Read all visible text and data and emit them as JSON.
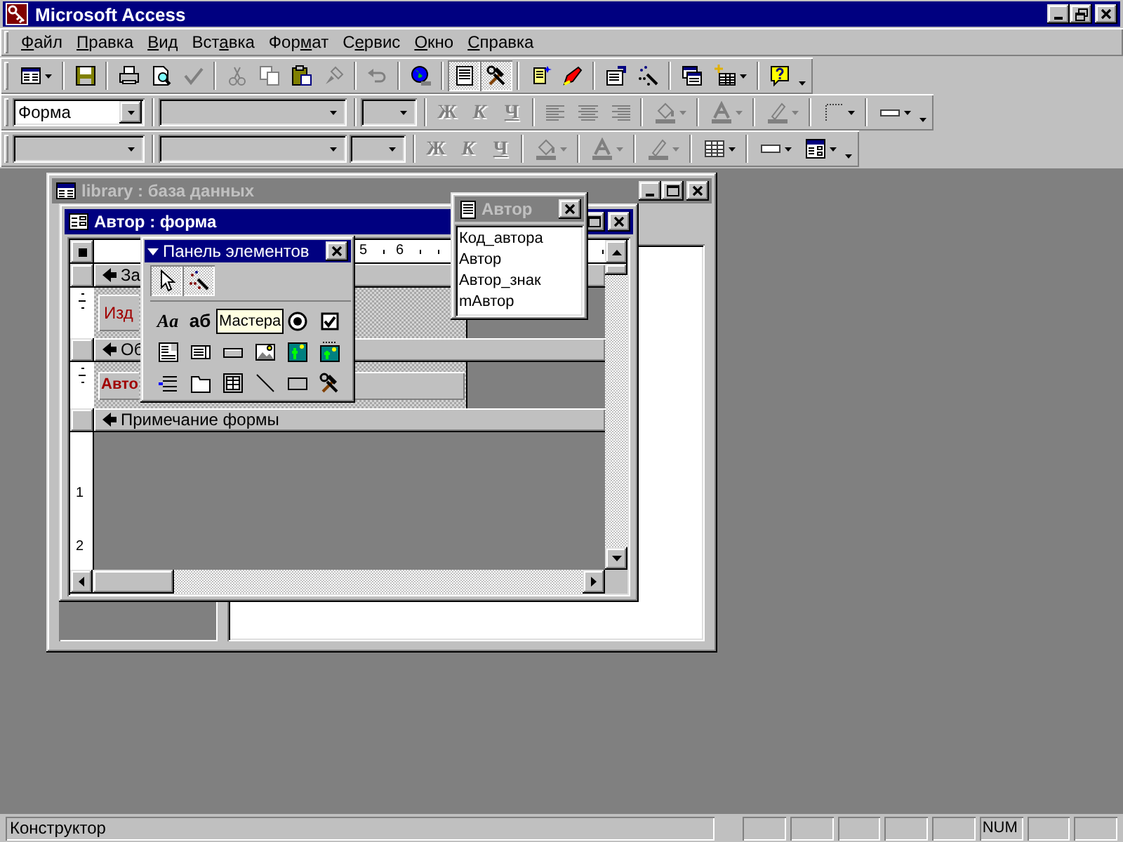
{
  "app_title": "Microsoft Access",
  "menu": [
    {
      "key": "Ф",
      "post": "айл"
    },
    {
      "key": "П",
      "post": "равка"
    },
    {
      "key": "В",
      "post": "ид"
    },
    {
      "pre": "Вст",
      "key": "а",
      "post": "вка"
    },
    {
      "pre": "Фор",
      "key": "м",
      "post": "ат"
    },
    {
      "pre": "С",
      "key": "е",
      "post": "рвис"
    },
    {
      "key": "О",
      "post": "кно"
    },
    {
      "key": "С",
      "post": "правка"
    }
  ],
  "toolbars": [
    {
      "items": [
        {
          "kind": "view",
          "split": true,
          "disabled": false,
          "pressed": false
        },
        {
          "kind": "separator"
        },
        {
          "kind": "save",
          "disabled": false,
          "pressed": false
        },
        {
          "kind": "separator"
        },
        {
          "kind": "print",
          "disabled": false,
          "pressed": false
        },
        {
          "kind": "preview",
          "disabled": false,
          "pressed": false
        },
        {
          "kind": "spelling",
          "disabled": true,
          "pressed": false
        },
        {
          "kind": "separator"
        },
        {
          "kind": "cut",
          "disabled": true,
          "pressed": false
        },
        {
          "kind": "copy",
          "disabled": true,
          "pressed": false
        },
        {
          "kind": "paste",
          "disabled": false,
          "pressed": false
        },
        {
          "kind": "painter",
          "disabled": true,
          "pressed": false
        },
        {
          "kind": "separator"
        },
        {
          "kind": "undo",
          "disabled": true,
          "pressed": false
        },
        {
          "kind": "separator"
        },
        {
          "kind": "web",
          "disabled": false,
          "pressed": false
        },
        {
          "kind": "separator"
        },
        {
          "kind": "field_list",
          "disabled": false,
          "pressed": true
        },
        {
          "kind": "toolbox",
          "disabled": false,
          "pressed": true
        },
        {
          "kind": "separator"
        },
        {
          "kind": "autoformat",
          "disabled": false,
          "pressed": false
        },
        {
          "kind": "code",
          "disabled": false,
          "pressed": false
        },
        {
          "kind": "separator"
        },
        {
          "kind": "properties",
          "disabled": false,
          "pressed": false
        },
        {
          "kind": "builder",
          "disabled": false,
          "pressed": false
        },
        {
          "kind": "separator"
        },
        {
          "kind": "database_window",
          "disabled": false,
          "pressed": false
        },
        {
          "kind": "new_object",
          "split": true,
          "disabled": false,
          "pressed": false
        },
        {
          "kind": "separator"
        },
        {
          "kind": "help",
          "disabled": false,
          "pressed": false
        },
        {
          "kind": "more"
        }
      ]
    },
    {
      "items": [
        {
          "kind": "combo",
          "value": "Форма",
          "disabled": false
        },
        {
          "kind": "separator"
        },
        {
          "kind": "combo",
          "disabled": true
        },
        {
          "kind": "separator"
        },
        {
          "kind": "combo",
          "disabled": true
        },
        {
          "kind": "separator"
        },
        {
          "kind": "bold",
          "label": "Ж",
          "disabled": true,
          "pressed": false
        },
        {
          "kind": "italic",
          "label": "К",
          "disabled": true,
          "pressed": false
        },
        {
          "kind": "underline",
          "label": "Ч",
          "disabled": true,
          "pressed": false
        },
        {
          "kind": "separator"
        },
        {
          "kind": "align_left",
          "disabled": true,
          "pressed": false
        },
        {
          "kind": "align_center",
          "disabled": true,
          "pressed": false
        },
        {
          "kind": "align_right",
          "disabled": true,
          "pressed": false
        },
        {
          "kind": "separator"
        },
        {
          "kind": "fill_color",
          "split": true,
          "disabled": true,
          "pressed": false
        },
        {
          "kind": "separator"
        },
        {
          "kind": "font_color",
          "split": true,
          "disabled": true,
          "pressed": false
        },
        {
          "kind": "separator"
        },
        {
          "kind": "line_color",
          "split": true,
          "disabled": true,
          "pressed": false
        },
        {
          "kind": "separator"
        },
        {
          "kind": "border",
          "split": true,
          "disabled": false,
          "pressed": false
        },
        {
          "kind": "separator"
        },
        {
          "kind": "line_width",
          "split": true,
          "disabled": false,
          "pressed": false
        },
        {
          "kind": "more"
        }
      ]
    },
    {
      "items": [
        {
          "kind": "combo",
          "disabled": true
        },
        {
          "kind": "separator"
        },
        {
          "kind": "combo",
          "disabled": true
        },
        {
          "kind": "combo",
          "disabled": true
        },
        {
          "kind": "separator"
        },
        {
          "kind": "bold",
          "label": "Ж",
          "disabled": true,
          "pressed": false
        },
        {
          "kind": "italic",
          "label": "К",
          "disabled": true,
          "pressed": false
        },
        {
          "kind": "underline",
          "label": "Ч",
          "disabled": true,
          "pressed": false
        },
        {
          "kind": "separator"
        },
        {
          "kind": "fill_color",
          "split": true,
          "disabled": true,
          "pressed": false
        },
        {
          "kind": "separator"
        },
        {
          "kind": "font_color",
          "split": true,
          "disabled": true,
          "pressed": false
        },
        {
          "kind": "separator"
        },
        {
          "kind": "line_color",
          "split": true,
          "disabled": true,
          "pressed": false
        },
        {
          "kind": "separator"
        },
        {
          "kind": "gridlines",
          "split": true,
          "disabled": false,
          "pressed": false
        },
        {
          "kind": "separator"
        },
        {
          "kind": "special_effect",
          "split": true,
          "disabled": false,
          "pressed": false
        },
        {
          "kind": "form_view",
          "split": true,
          "disabled": false,
          "pressed": false
        },
        {
          "kind": "more"
        }
      ]
    }
  ],
  "database_window": {
    "title": "library : база данных",
    "active": false
  },
  "form_window": {
    "title": "Автор : форма",
    "active": true,
    "ruler_marks": [
      "5",
      "6"
    ],
    "vertical_ruler_marks": [
      "1",
      "2"
    ],
    "sections": [
      {
        "kind": "bar",
        "label": "За"
      },
      {
        "kind": "area",
        "control": {
          "kind": "label",
          "text": "Изд"
        }
      },
      {
        "kind": "bar",
        "label": "Об"
      },
      {
        "kind": "area",
        "control": {
          "kind": "textbox",
          "text": "Авто"
        }
      },
      {
        "kind": "bar",
        "label": "Примечание формы"
      }
    ]
  },
  "toolbox": {
    "title": "Панель элементов",
    "active": true,
    "tooltip": "Мастера",
    "top_buttons": [
      {
        "kind": "select",
        "pressed": true
      },
      {
        "kind": "wizard",
        "pressed": true
      }
    ],
    "buttons": [
      {
        "kind": "label",
        "text": "Aa"
      },
      {
        "kind": "textbox",
        "text": "аб"
      },
      {
        "kind": "tooltip"
      },
      {
        "kind": "radio"
      },
      {
        "kind": "checkbox"
      },
      {
        "kind": "combo"
      },
      {
        "kind": "listbox"
      },
      {
        "kind": "command"
      },
      {
        "kind": "image"
      },
      {
        "kind": "unbound_frame"
      },
      {
        "kind": "bound_frame"
      },
      {
        "kind": "page_break"
      },
      {
        "kind": "tab"
      },
      {
        "kind": "subform"
      },
      {
        "kind": "line"
      },
      {
        "kind": "rectangle"
      },
      {
        "kind": "more_controls"
      }
    ]
  },
  "field_list": {
    "title": "Автор",
    "active": false,
    "fields": [
      "Код_автора",
      "Автор",
      "Автор_знак",
      "mАвтор"
    ]
  },
  "status_bar": {
    "text": "Конструктор",
    "indicators": [
      "NUM"
    ]
  }
}
